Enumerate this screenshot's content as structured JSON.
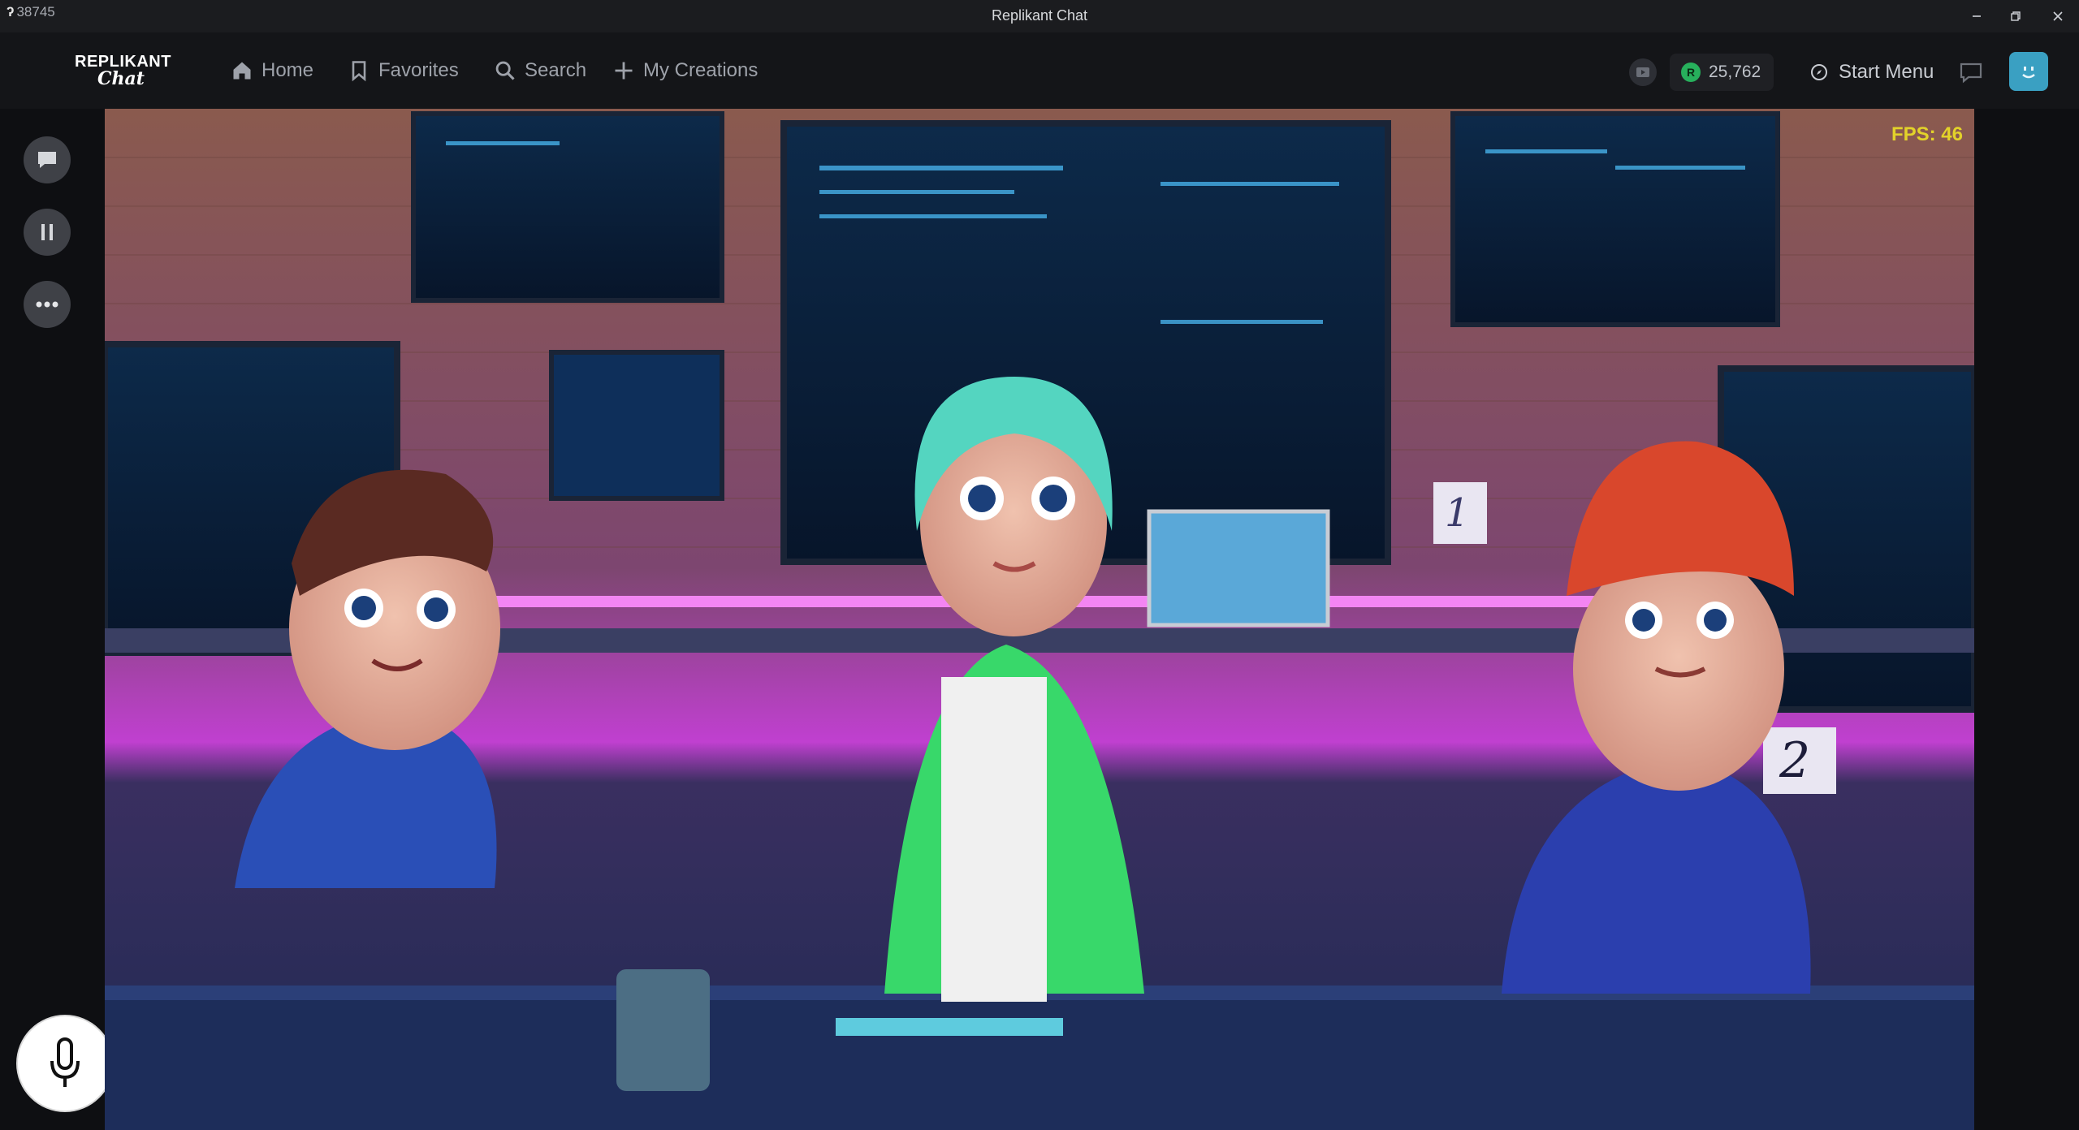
{
  "titlebar": {
    "app_code": "38745",
    "title": "Replikant Chat"
  },
  "logo": {
    "line1": "REPLIKANT",
    "line2": "Chat"
  },
  "nav": {
    "home": "Home",
    "favorites": "Favorites",
    "search": "Search",
    "my_creations": "My Creations"
  },
  "header": {
    "coins": "25,762",
    "start_menu": "Start Menu"
  },
  "scene": {
    "fps_label": "FPS: 46",
    "note_1": "1",
    "note_2": "2"
  },
  "colors": {
    "accent": "#3aa0c2",
    "coin": "#27b05c",
    "fps": "#e2d22a"
  }
}
